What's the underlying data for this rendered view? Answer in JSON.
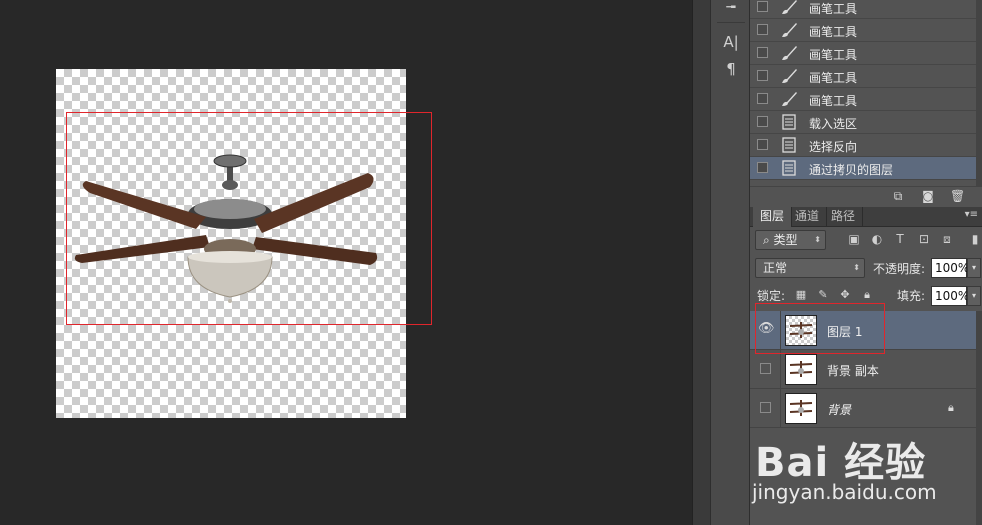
{
  "history": {
    "items": [
      {
        "label": "画笔工具",
        "icon": "brush-icon",
        "active": false
      },
      {
        "label": "画笔工具",
        "icon": "brush-icon",
        "active": false
      },
      {
        "label": "画笔工具",
        "icon": "brush-icon",
        "active": false
      },
      {
        "label": "画笔工具",
        "icon": "brush-icon",
        "active": false
      },
      {
        "label": "画笔工具",
        "icon": "brush-icon",
        "active": false
      },
      {
        "label": "载入选区",
        "icon": "document-icon",
        "active": false
      },
      {
        "label": "选择反向",
        "icon": "document-icon",
        "active": false
      },
      {
        "label": "通过拷贝的图层",
        "icon": "document-icon",
        "active": true
      }
    ]
  },
  "layers_panel": {
    "tabs": [
      {
        "label": "图层",
        "active": true
      },
      {
        "label": "通道",
        "active": false
      },
      {
        "label": "路径",
        "active": false
      }
    ],
    "filter_kind": "类型",
    "blend_mode": "正常",
    "opacity_label": "不透明度:",
    "opacity_value": "100%",
    "lock_label": "锁定:",
    "fill_label": "填充:",
    "fill_value": "100%",
    "layers": [
      {
        "name": "图层 1",
        "visible": true,
        "selected": true,
        "locked": false
      },
      {
        "name": "背景 副本",
        "visible": false,
        "selected": false,
        "locked": false
      },
      {
        "name": "背景",
        "visible": false,
        "selected": false,
        "locked": true
      }
    ]
  },
  "toolstrip": {
    "icons": [
      "brush-preset-icon",
      "character-icon",
      "paragraph-icon"
    ]
  },
  "watermark": {
    "logo": "Bai 经验",
    "url": "jingyan.baidu.com"
  },
  "colors": {
    "selection_outline": "#e0262c",
    "active_row": "#5d6a7e",
    "panel_bg": "#535353",
    "canvas_bg": "#282828"
  }
}
